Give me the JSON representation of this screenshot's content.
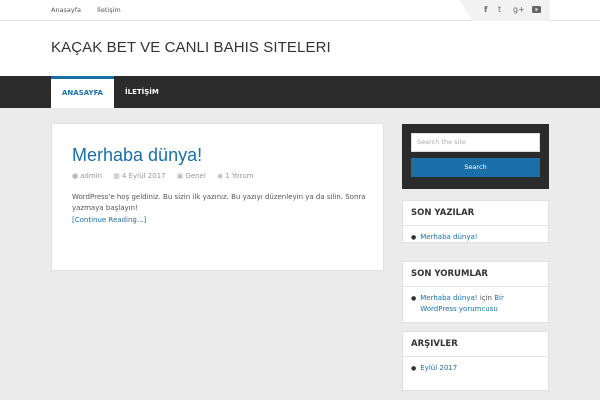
{
  "topbar": {
    "links": [
      "Anasayfa",
      "İletişim"
    ],
    "social": [
      "f",
      "t",
      "g+",
      "yt"
    ]
  },
  "header": {
    "site_title": "KAÇAK BET VE CANLI BAHIS SITELERI"
  },
  "nav": {
    "items": [
      "ANASAYFA",
      "İLETİŞİM"
    ]
  },
  "post": {
    "title": "Merhaba dünya!",
    "author": "admin",
    "date": "4 Eylül 2017",
    "category": "Genel",
    "comments": "1 Yorum",
    "excerpt": "WordPress'e hoş geldiniz. Bu sizin ilk yazınız. Bu yazıyı düzenleyin ya da silin. Sonra yazmaya başlayın!",
    "read_more": "[Continue Reading...]"
  },
  "sidebar": {
    "search": {
      "placeholder": "Search the site",
      "button": "Search"
    },
    "recent_posts": {
      "title": "SON YAZILAR",
      "items": [
        "Merhaba dünya!"
      ]
    },
    "recent_comments": {
      "title": "SON YORUMLAR",
      "item": {
        "post": "Merhaba dünya!",
        "joiner": " için ",
        "author": "Bir WordPress yorumcusu"
      }
    },
    "archives": {
      "title": "ARŞIVLER",
      "items": [
        "Eylül 2017"
      ]
    }
  },
  "colors": {
    "accent": "#1a6fa8",
    "nav_bg": "#2b2b2b",
    "page_bg": "#ebebeb"
  }
}
